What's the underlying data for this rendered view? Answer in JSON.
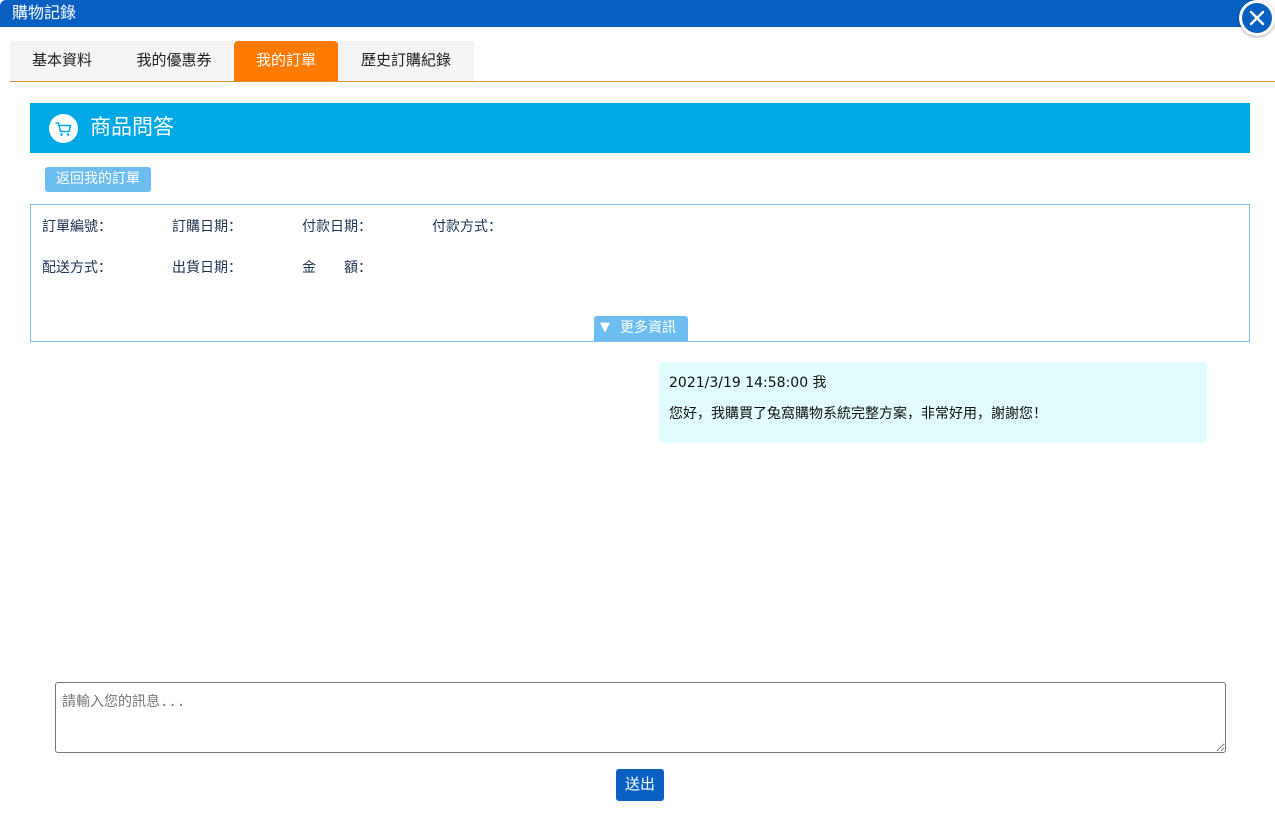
{
  "window": {
    "title": "購物記錄",
    "close_icon": "close-icon"
  },
  "tabs": [
    {
      "label": "基本資料",
      "active": false
    },
    {
      "label": "我的優惠券",
      "active": false
    },
    {
      "label": "我的訂單",
      "active": true
    },
    {
      "label": "歷史訂購紀錄",
      "active": false
    }
  ],
  "section": {
    "title": "商品問答",
    "icon": "cart-icon"
  },
  "back_button": "返回我的訂單",
  "order_info": {
    "order_no_label": "訂單編號：",
    "order_date_label": "訂購日期：",
    "pay_date_label": "付款日期：",
    "pay_method_label": "付款方式：",
    "ship_method_label": "配送方式：",
    "ship_date_label": "出貨日期：",
    "amount_label": "金　　額：",
    "more_button": "更多資訊",
    "more_icon": "▼"
  },
  "messages": [
    {
      "meta": "2021/3/19 14:58:00 我",
      "text": "您好，我購買了兔窩購物系統完整方案，非常好用，謝謝您！"
    }
  ],
  "composer": {
    "placeholder": "請輸入您的訊息...",
    "value": "",
    "send_label": "送出"
  },
  "colors": {
    "titlebar": "#0a5fc2",
    "active_tab": "#ff7a00",
    "section_header": "#00a8e6",
    "light_button": "#6dbdf0",
    "message_bubble": "#e2fbfd",
    "send_button": "#0a5fc2"
  }
}
